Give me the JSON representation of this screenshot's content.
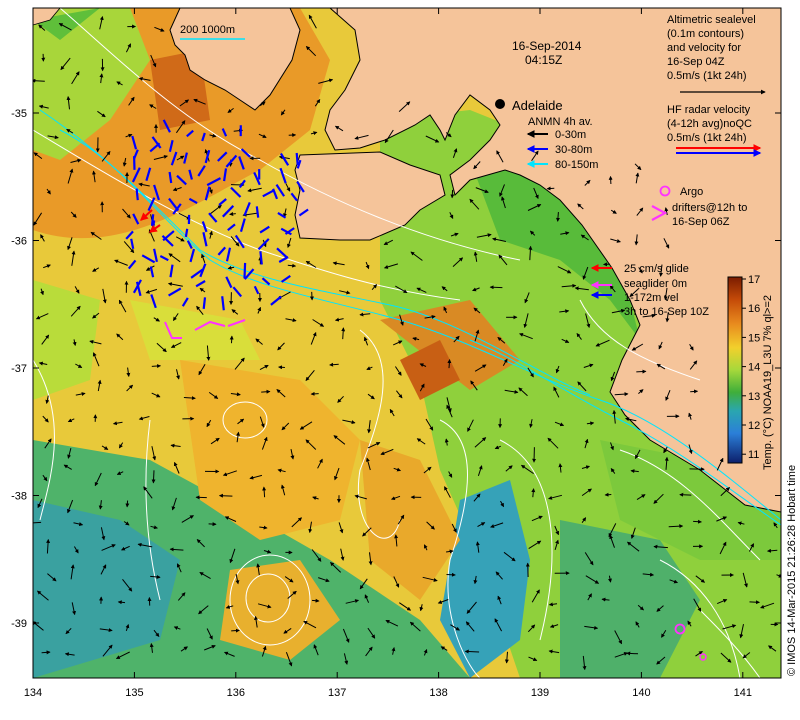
{
  "title": {
    "date": "16-Sep-2014",
    "time": "04:15Z"
  },
  "scale_bar": "200  1000m",
  "city": {
    "name": "Adelaide"
  },
  "axes": {
    "x_ticks": [
      "134",
      "135",
      "136",
      "137",
      "138",
      "139",
      "140",
      "141"
    ],
    "y_ticks": [
      "-35",
      "-36",
      "-37",
      "-38",
      "-39"
    ]
  },
  "legend_altimetric": {
    "line1": "Altimetric sealevel",
    "line2": "(0.1m contours)",
    "line3": "and velocity for",
    "line4": "16-Sep 04Z",
    "line5": "0.5m/s (1kt 24h)"
  },
  "legend_hf": {
    "line1": "HF radar velocity",
    "line2": "(4-12h avg)noQC",
    "line3": "0.5m/s (1kt 24h)"
  },
  "legend_anmn": {
    "title": "ANMN 4h av.",
    "items": [
      {
        "label": "0-30m",
        "color": "#000000"
      },
      {
        "label": "30-80m",
        "color": "#0000ff"
      },
      {
        "label": "80-150m",
        "color": "#00e5ff"
      }
    ]
  },
  "legend_argo": {
    "line1": "Argo",
    "line2": "drifters@12h to",
    "line3": "16-Sep 06Z",
    "color": "#ff33ff"
  },
  "legend_glider": {
    "line1": "25 cm/s glide",
    "line2": "seaglider 0m",
    "line3": "1-172m vel",
    "line4": "3h to 16-Sep 10Z"
  },
  "colorbar": {
    "ticks": [
      "17",
      "16",
      "15",
      "14",
      "13",
      "12",
      "11"
    ],
    "label": "Temp. (°C) NOAA19_L3U 7% ql>=2",
    "colors": [
      "#7a1c00",
      "#b23a00",
      "#d4560f",
      "#e98a1e",
      "#f3b32a",
      "#f2d52d",
      "#d9e23a",
      "#a6d83b",
      "#6cc63d",
      "#3fae3a",
      "#2c9c6d",
      "#2aa6b0",
      "#2b8fd8",
      "#2262c8",
      "#18389e",
      "#0d1f6b"
    ]
  },
  "credit": "© IMOS 14-Mar-2015 21:26:28 Hobart time",
  "colors": {
    "land": "#f5c49a",
    "coast": "#000000",
    "contour": "#ffffff",
    "isobath": "#00e5ff",
    "argo": "#ff33ff"
  }
}
